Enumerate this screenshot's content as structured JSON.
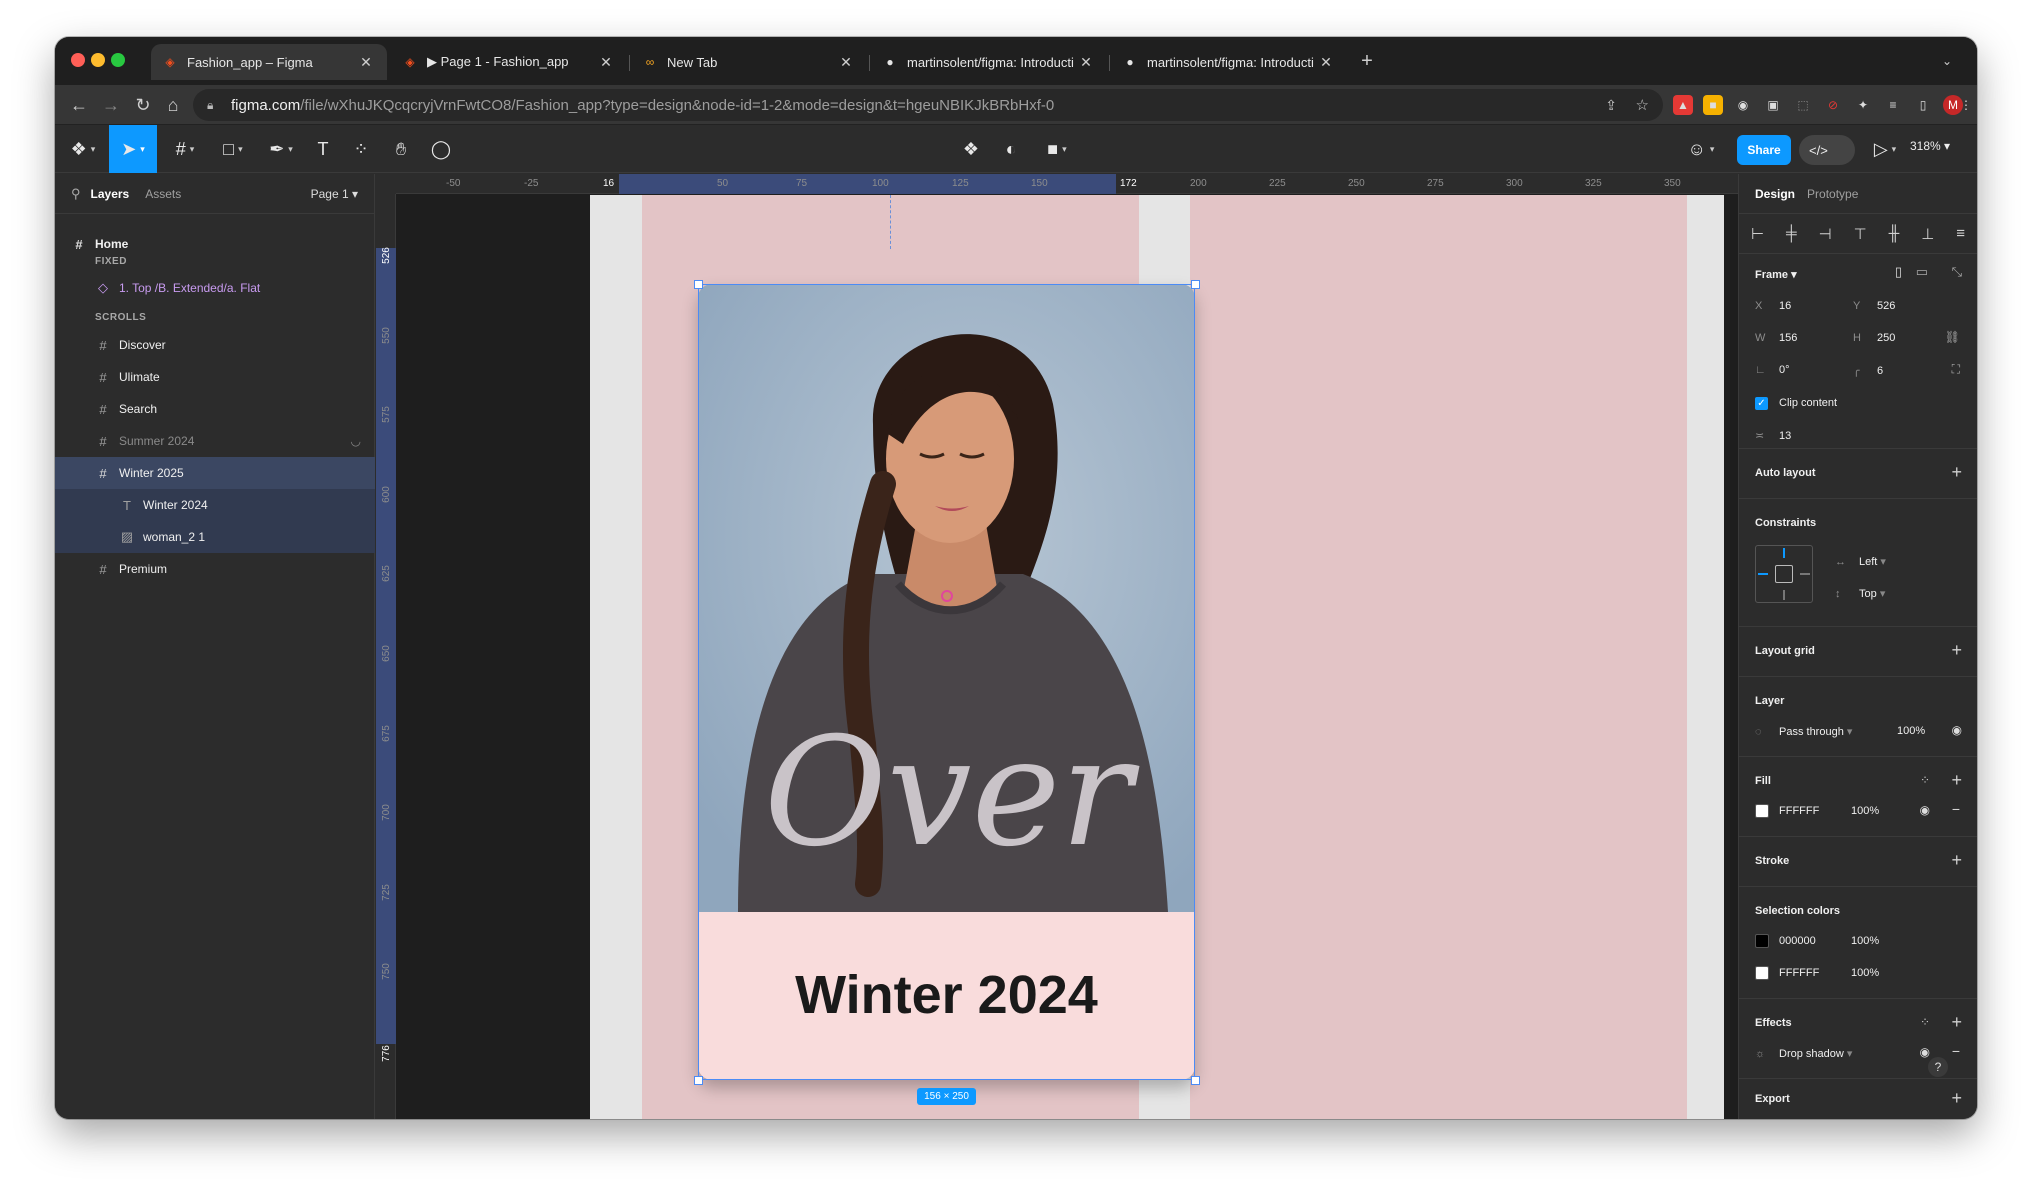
{
  "browser": {
    "tabs": [
      {
        "title": "Fashion_app – Figma",
        "icon": "figma-icon",
        "active": true
      },
      {
        "title": "▶ Page 1 - Fashion_app",
        "icon": "figma-icon",
        "active": false
      },
      {
        "title": "New Tab",
        "icon": "infinity-icon",
        "active": false
      },
      {
        "title": "martinsolent/figma: Introducti",
        "icon": "github-icon",
        "active": false
      },
      {
        "title": "martinsolent/figma: Introducti",
        "icon": "github-icon",
        "active": false
      }
    ],
    "url_host": "figma.com",
    "url_path": "/file/wXhuJKQcqcryjVrnFwtCO8/Fashion_app?type=design&node-id=1-2&mode=design&t=hgeuNBIKJkBRbHxf-0",
    "profile_initial": "M"
  },
  "toolbar": {
    "share_label": "Share",
    "zoom": "318%"
  },
  "layers_panel": {
    "tab_layers": "Layers",
    "tab_assets": "Assets",
    "page": "Page 1",
    "home": "Home",
    "fixed_label": "FIXED",
    "fixed_item": "1. Top /B. Extended/a. Flat",
    "scrolls_label": "SCROLLS",
    "items": [
      {
        "name": "Discover"
      },
      {
        "name": "Ulimate"
      },
      {
        "name": "Search"
      },
      {
        "name": "Summer 2024"
      },
      {
        "name": "Winter 2025"
      },
      {
        "name": "Winter 2024"
      },
      {
        "name": "woman_2 1"
      },
      {
        "name": "Premium"
      }
    ]
  },
  "canvas": {
    "ruler_top": [
      "-50",
      "-25",
      "16",
      "50",
      "75",
      "100",
      "125",
      "150",
      "172",
      "200",
      "225",
      "250",
      "275",
      "300",
      "325",
      "350"
    ],
    "ruler_left": [
      "526",
      "550",
      "575",
      "600",
      "625",
      "650",
      "675",
      "700",
      "725",
      "750",
      "776"
    ],
    "card_title": "Winter 2024",
    "shirt_text": "Over",
    "size_badge": "156 × 250"
  },
  "design_panel": {
    "tab_design": "Design",
    "tab_prototype": "Prototype",
    "frame_label": "Frame",
    "x_label": "X",
    "x": "16",
    "y_label": "Y",
    "y": "526",
    "w_label": "W",
    "w": "156",
    "h_label": "H",
    "h": "250",
    "rotation": "0°",
    "radius": "6",
    "clip_content": "Clip content",
    "spacing": "13",
    "auto_layout": "Auto layout",
    "constraints": "Constraints",
    "constraint_h": "Left",
    "constraint_v": "Top",
    "layout_grid": "Layout grid",
    "layer": "Layer",
    "blend_mode": "Pass through",
    "layer_opacity": "100%",
    "fill": "Fill",
    "fill_hex": "FFFFFF",
    "fill_opacity": "100%",
    "stroke": "Stroke",
    "selection_colors": "Selection colors",
    "sel_colors": [
      {
        "hex": "000000",
        "opacity": "100%",
        "color": "#000000"
      },
      {
        "hex": "FFFFFF",
        "opacity": "100%",
        "color": "#ffffff"
      }
    ],
    "effects": "Effects",
    "effect_name": "Drop shadow",
    "export": "Export"
  },
  "colors": {
    "accent": "#0d99ff",
    "selection": "#4c8bf5",
    "card_bg": "#f9dcdc",
    "column_pink": "#e3c4c6"
  }
}
